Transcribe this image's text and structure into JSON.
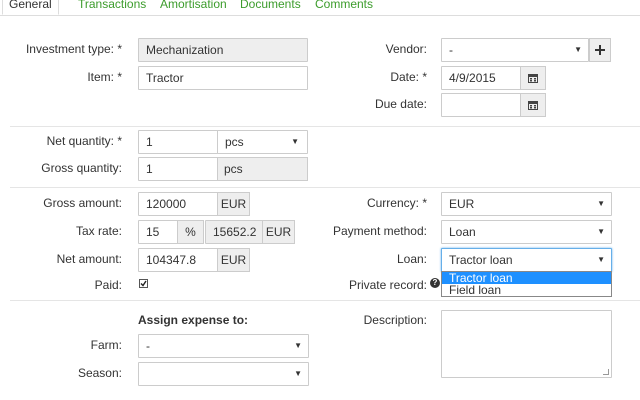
{
  "tabs": [
    {
      "label": "General"
    },
    {
      "label": "Transactions"
    },
    {
      "label": "Amortisation"
    },
    {
      "label": "Documents"
    },
    {
      "label": "Comments"
    }
  ],
  "left": {
    "investment_type_label": "Investment type: *",
    "investment_type_value": "Mechanization",
    "item_label": "Item: *",
    "item_value": "Tractor",
    "net_quantity_label": "Net quantity: *",
    "net_quantity_value": "1",
    "net_quantity_unit": "pcs",
    "gross_quantity_label": "Gross quantity:",
    "gross_quantity_value": "1",
    "gross_quantity_unit": "pcs",
    "gross_amount_label": "Gross amount:",
    "gross_amount_value": "120000",
    "gross_amount_currency": "EUR",
    "tax_rate_label": "Tax rate:",
    "tax_rate_value": "15",
    "tax_rate_percent": "%",
    "tax_amount_value": "15652.2",
    "tax_amount_currency": "EUR",
    "net_amount_label": "Net amount:",
    "net_amount_value": "104347.8",
    "net_amount_currency": "EUR",
    "paid_label": "Paid:",
    "paid_checked": true,
    "assign_heading": "Assign expense to:",
    "farm_label": "Farm:",
    "farm_value": "-",
    "season_label": "Season:",
    "season_value": ""
  },
  "right": {
    "vendor_label": "Vendor:",
    "vendor_value": "-",
    "date_label": "Date: *",
    "date_value": "4/9/2015",
    "due_date_label": "Due date:",
    "due_date_value": "",
    "currency_label": "Currency: *",
    "currency_value": "EUR",
    "payment_method_label": "Payment method:",
    "payment_method_value": "Loan",
    "loan_label": "Loan:",
    "loan_value": "Tractor loan",
    "loan_options": [
      "Tractor loan",
      "Field loan"
    ],
    "private_record_label": "Private record:",
    "description_label": "Description:",
    "description_value": ""
  },
  "colors": {
    "tab_link": "#3c9c2c",
    "dropdown_selected": "#1e90ff",
    "readonly_bg": "#eeeeee",
    "border": "#cccccc"
  },
  "icons": {
    "select_caret": "caret-down-icon",
    "vendor_add": "plus-icon",
    "calendar": "calendar-icon",
    "help": "question-circle-icon",
    "checkbox": "checkbox-checked-icon"
  }
}
